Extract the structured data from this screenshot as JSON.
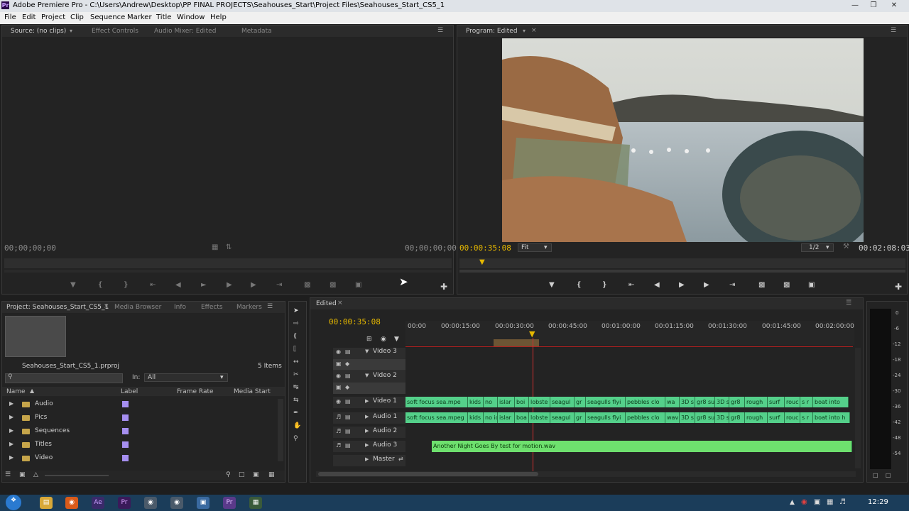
{
  "window": {
    "title": "Adobe Premiere Pro - C:\\Users\\Andrew\\Desktop\\PP FINAL PROJECTS\\Seahouses_Start\\Project Files\\Seahouses_Start_CS5_1"
  },
  "menu": [
    "File",
    "Edit",
    "Project",
    "Clip",
    "Sequence",
    "Marker",
    "Title",
    "Window",
    "Help"
  ],
  "source_panel": {
    "tabs": [
      "Source: (no clips)",
      "Effect Controls",
      "Audio Mixer: Edited",
      "Metadata"
    ],
    "timecode_left": "00;00;00;00",
    "timecode_right": "00;00;00;00"
  },
  "program_panel": {
    "tab": "Program: Edited",
    "timecode_current": "00:00:35:08",
    "fit": "Fit",
    "resolution": "1/2",
    "timecode_duration": "00:02:08:03"
  },
  "project_panel": {
    "tabs": [
      "Project: Seahouses_Start_CS5_1",
      "Media Browser",
      "Info",
      "Effects",
      "Markers"
    ],
    "project_file": "Seahouses_Start_CS5_1.prproj",
    "items_count": "5 Items",
    "search_placeholder": "",
    "in_label": "In:",
    "in_value": "All",
    "columns": [
      "Name",
      "Label",
      "Frame Rate",
      "Media Start"
    ],
    "bins": [
      "Audio",
      "Pics",
      "Sequences",
      "Titles",
      "Video"
    ],
    "label_color": "#a68ff0"
  },
  "timeline": {
    "tab": "Edited",
    "timecode": "00:00:35:08",
    "ruler": [
      "00:00",
      "00:00:15:00",
      "00:00:30:00",
      "00:00:45:00",
      "00:01:00:00",
      "00:01:15:00",
      "00:01:30:00",
      "00:01:45:00",
      "00:02:00:00"
    ],
    "tracks": [
      "Video 3",
      "Video 2",
      "Video 1",
      "Audio 1",
      "Audio 2",
      "Audio 3",
      "Master"
    ],
    "video1_clips": [
      "soft focus sea.mpe",
      "kids",
      "no",
      "islar",
      "boi",
      "lobste",
      "seagul",
      "gr",
      "seagulls flyi",
      "pebbles clo",
      "wa",
      "3D s",
      "gr8 su",
      "3D s",
      "gr8",
      "rough",
      "surf",
      "rouc",
      "s r",
      "boat into"
    ],
    "audio1_clips": [
      "soft focus sea.mpeg",
      "kids",
      "no ic",
      "islar",
      "boa",
      "lobste",
      "seagul",
      "gr",
      "seagulls flyi",
      "pebbles clo",
      "wav",
      "3D s",
      "gr8 su",
      "3D s",
      "gr8",
      "rough",
      "surf",
      "rouc",
      "s r",
      "boat into h"
    ],
    "audio3_clip": "Another Night Goes By test for motion.wav",
    "clip_color": "#54d08a",
    "audio3_color": "#6ee06e"
  },
  "meter": {
    "labels": [
      "0",
      "-6",
      "-12",
      "-18",
      "-24",
      "-30",
      "-36",
      "-42",
      "-48",
      "-54"
    ]
  },
  "taskbar": {
    "clock": "12:29"
  },
  "colors": {
    "accent": "#e6b800",
    "background": "#232323"
  }
}
